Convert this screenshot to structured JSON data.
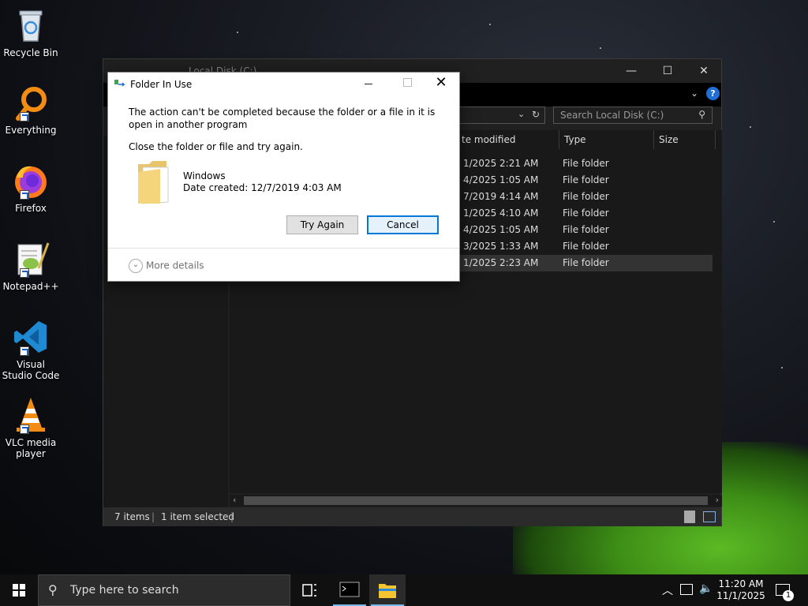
{
  "desktop": {
    "icons": [
      {
        "label": "Recycle Bin"
      },
      {
        "label": "Everything"
      },
      {
        "label": "Firefox"
      },
      {
        "label": "Notepad++"
      },
      {
        "label": "Visual Studio Code"
      },
      {
        "label": "VLC media player"
      }
    ]
  },
  "explorer": {
    "title": "Local Disk (C:)",
    "search_placeholder": "Search Local Disk (C:)",
    "columns": [
      "te modified",
      "Type",
      "Size"
    ],
    "rows": [
      {
        "date": "1/2025 2:21 AM",
        "type": "File folder"
      },
      {
        "date": "4/2025 1:05 AM",
        "type": "File folder"
      },
      {
        "date": "7/2019 4:14 AM",
        "type": "File folder"
      },
      {
        "date": "1/2025 4:10 AM",
        "type": "File folder"
      },
      {
        "date": "4/2025 1:05 AM",
        "type": "File folder"
      },
      {
        "date": "3/2025 1:33 AM",
        "type": "File folder"
      },
      {
        "date": "1/2025 2:23 AM",
        "type": "File folder"
      }
    ],
    "selected_row_index": 6,
    "status": {
      "items": "7 items",
      "selected": "1 item selected"
    }
  },
  "dialog": {
    "title": "Folder In Use",
    "message": "The action can't be completed because the folder or a file in it is open in another program",
    "instruction": "Close the folder or file and try again.",
    "item_name": "Windows",
    "item_date": "Date created: 12/7/2019 4:03 AM",
    "try_again_label": "Try Again",
    "cancel_label": "Cancel",
    "more_details_label": "More details"
  },
  "taskbar": {
    "search_placeholder": "Type here to search",
    "time": "11:20 AM",
    "date": "11/1/2025",
    "notification_count": "1"
  },
  "colors": {
    "accent": "#0078d7",
    "explorer_bg": "#191919",
    "taskbar_bg": "#101010"
  }
}
